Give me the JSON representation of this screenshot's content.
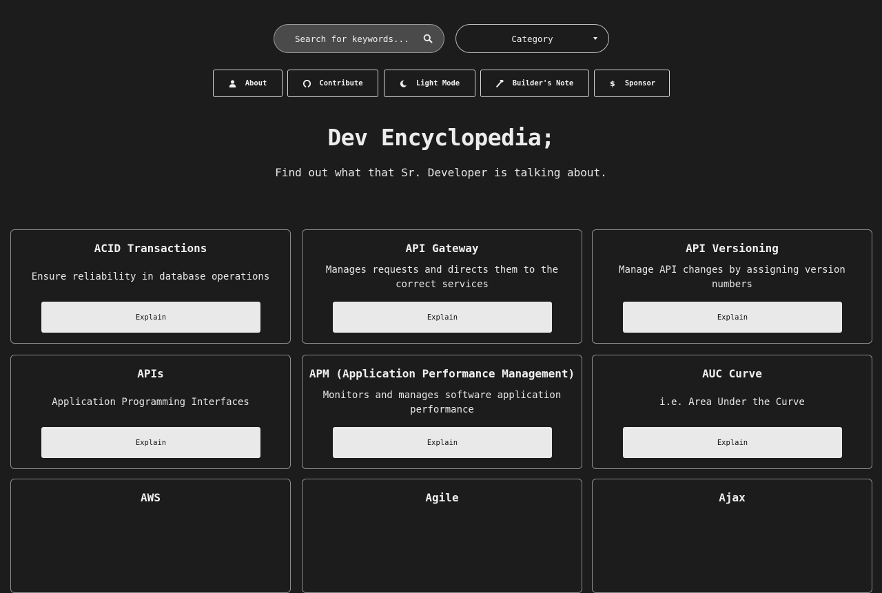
{
  "search": {
    "placeholder": "Search for keywords..."
  },
  "category": {
    "label": "Category"
  },
  "nav": [
    {
      "label": "About",
      "icon": "user-icon"
    },
    {
      "label": "Contribute",
      "icon": "github-icon"
    },
    {
      "label": "Light Mode",
      "icon": "moon-icon"
    },
    {
      "label": "Builder's Note",
      "icon": "hammer-icon"
    },
    {
      "label": "Sponsor",
      "icon": "dollar-icon"
    }
  ],
  "page": {
    "title": "Dev Encyclopedia;",
    "subtitle": "Find out what that Sr. Developer is talking about."
  },
  "explain_label": "Explain",
  "cards": [
    {
      "title": "ACID Transactions",
      "desc": "Ensure reliability in database operations"
    },
    {
      "title": "API Gateway",
      "desc": "Manages requests and directs them to the correct services"
    },
    {
      "title": "API Versioning",
      "desc": "Manage API changes by assigning version numbers"
    },
    {
      "title": "APIs",
      "desc": "Application Programming Interfaces"
    },
    {
      "title": "APM (Application Performance Management)",
      "desc": "Monitors and manages software application performance"
    },
    {
      "title": "AUC Curve",
      "desc": "i.e. Area Under the Curve"
    },
    {
      "title": "AWS",
      "desc": ""
    },
    {
      "title": "Agile",
      "desc": ""
    },
    {
      "title": "Ajax",
      "desc": ""
    }
  ]
}
